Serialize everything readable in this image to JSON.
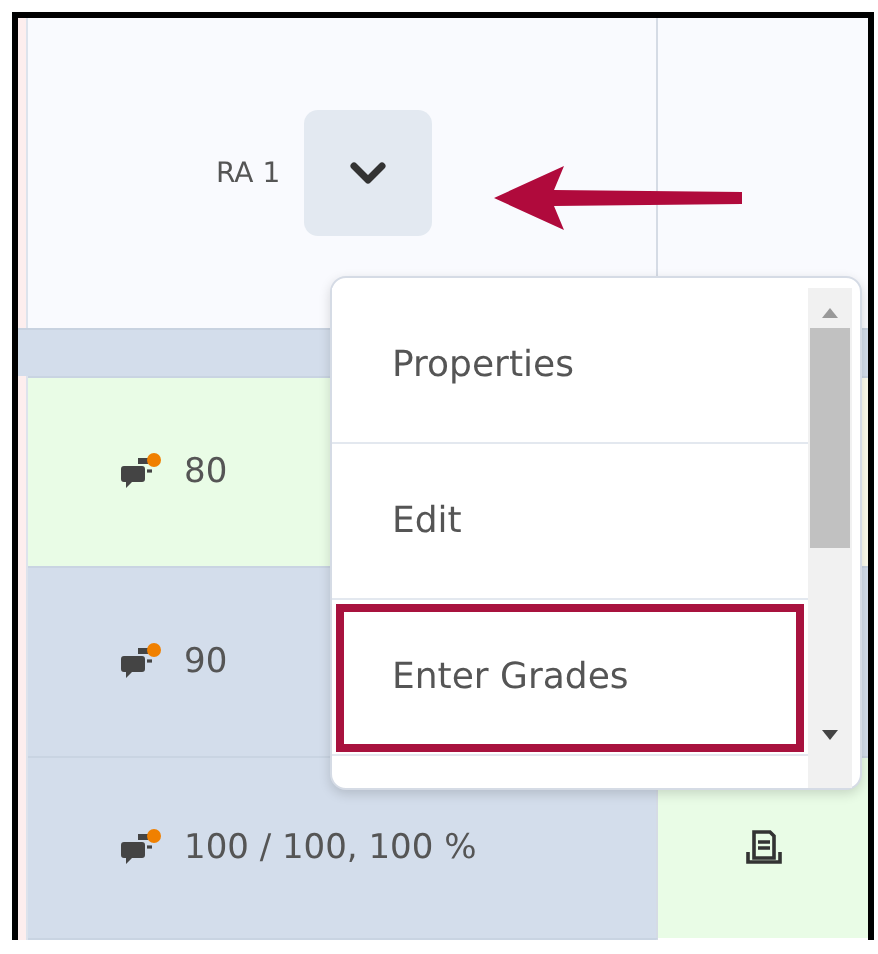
{
  "column_header": {
    "label": "RA 1"
  },
  "rows": [
    {
      "grade": "80",
      "color": "#e9fce6",
      "side_cell": {
        "color": "#fdfdee",
        "kind": "empty"
      }
    },
    {
      "grade": "90",
      "color": "#d3ddeb",
      "side_cell": {
        "color": "#d3ddeb",
        "kind": "empty"
      }
    },
    {
      "grade": "100 / 100, 100 %",
      "color": "#d3ddeb",
      "side_cell": {
        "color": "#e9fce6",
        "kind": "document"
      }
    }
  ],
  "menu": {
    "items": [
      {
        "label": "Properties",
        "highlighted": false
      },
      {
        "label": "Edit",
        "highlighted": false
      },
      {
        "label": "Enter Grades",
        "highlighted": true
      }
    ]
  }
}
